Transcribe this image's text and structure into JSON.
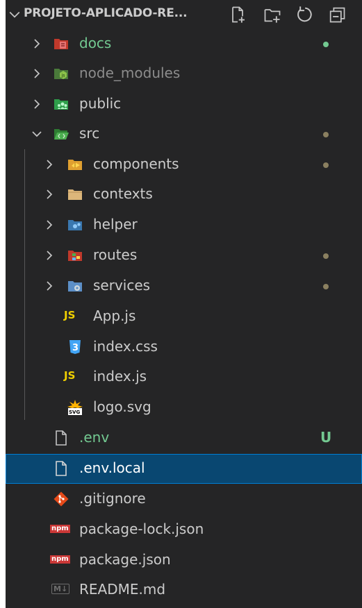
{
  "explorer": {
    "title": "PROJETO-APLICADO-RE...",
    "actions": [
      "new-file-icon",
      "new-folder-icon",
      "refresh-icon",
      "collapse-all-icon"
    ]
  },
  "items": [
    {
      "label": "docs",
      "kind": "folder",
      "expanded": false,
      "depth": 1,
      "label_color": "green",
      "decoration": "dot-green"
    },
    {
      "label": "node_modules",
      "kind": "folder",
      "expanded": false,
      "depth": 1,
      "label_color": "muted",
      "decoration": ""
    },
    {
      "label": "public",
      "kind": "folder",
      "expanded": false,
      "depth": 1,
      "label_color": "default",
      "decoration": ""
    },
    {
      "label": "src",
      "kind": "folder",
      "expanded": true,
      "depth": 1,
      "label_color": "default",
      "decoration": "dot-grey"
    },
    {
      "label": "components",
      "kind": "folder",
      "expanded": false,
      "depth": 2,
      "label_color": "default",
      "decoration": "dot-grey"
    },
    {
      "label": "contexts",
      "kind": "folder",
      "expanded": false,
      "depth": 2,
      "label_color": "default",
      "decoration": ""
    },
    {
      "label": "helper",
      "kind": "folder",
      "expanded": false,
      "depth": 2,
      "label_color": "default",
      "decoration": ""
    },
    {
      "label": "routes",
      "kind": "folder",
      "expanded": false,
      "depth": 2,
      "label_color": "default",
      "decoration": "dot-grey"
    },
    {
      "label": "services",
      "kind": "folder",
      "expanded": false,
      "depth": 2,
      "label_color": "default",
      "decoration": "dot-grey"
    },
    {
      "label": "App.js",
      "kind": "file",
      "depth": 2,
      "label_color": "default",
      "decoration": ""
    },
    {
      "label": "index.css",
      "kind": "file",
      "depth": 2,
      "label_color": "default",
      "decoration": ""
    },
    {
      "label": "index.js",
      "kind": "file",
      "depth": 2,
      "label_color": "default",
      "decoration": ""
    },
    {
      "label": "logo.svg",
      "kind": "file",
      "depth": 2,
      "label_color": "default",
      "decoration": ""
    },
    {
      "label": ".env",
      "kind": "file",
      "depth": 1,
      "label_color": "green",
      "decoration": "U"
    },
    {
      "label": ".env.local",
      "kind": "file",
      "depth": 1,
      "label_color": "default",
      "decoration": "",
      "selected": true
    },
    {
      "label": ".gitignore",
      "kind": "file",
      "depth": 1,
      "label_color": "default",
      "decoration": ""
    },
    {
      "label": "package-lock.json",
      "kind": "file",
      "depth": 1,
      "label_color": "default",
      "decoration": ""
    },
    {
      "label": "package.json",
      "kind": "file",
      "depth": 1,
      "label_color": "default",
      "decoration": ""
    },
    {
      "label": "README.md",
      "kind": "file",
      "depth": 1,
      "label_color": "default",
      "decoration": ""
    }
  ],
  "icons": {
    "js_badge": "JS",
    "css_badge": "3",
    "svg_badge": "SVG",
    "npm_badge": "npm",
    "md_badge": "M↓"
  },
  "colors": {
    "sidebar_bg": "#252526",
    "selection_bg": "#094771",
    "selection_border": "#007fd4",
    "git_untracked": "#73c991",
    "text": "#cccccc"
  }
}
